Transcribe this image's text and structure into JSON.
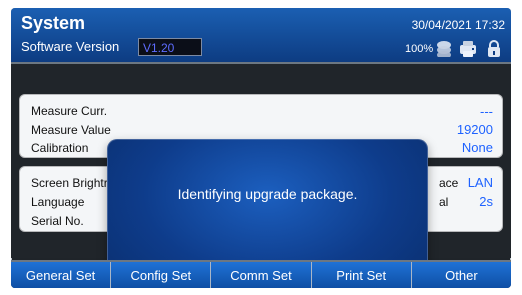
{
  "colors": {
    "header_blue": "#1b5fb2",
    "header_blue_dark": "#0d3c82",
    "panel_bg": "#f4f6f8",
    "value_blue": "#1e62ff",
    "overlay_blue": "#1c5fbf",
    "tab_blue": "#1f72d6"
  },
  "header": {
    "title": "System",
    "software_version_label": "Software Version",
    "software_version_value": "V1.20",
    "datetime": "30/04/2021 17:32",
    "battery_percent": "100%",
    "status_icons": [
      "network-icon",
      "printer-icon",
      "lock-icon"
    ]
  },
  "settings": {
    "rows": [
      {
        "label": "Measure Curr.",
        "value": "---"
      },
      {
        "label": "Measure Value",
        "value": "19200"
      },
      {
        "label": "Calibration",
        "value": "None"
      },
      {
        "label": "Screen Brightr",
        "value": "LAN",
        "right_label": "ace"
      },
      {
        "label": "Language",
        "value": "2s",
        "right_label": "al"
      },
      {
        "label": "Serial No.",
        "value": ""
      }
    ]
  },
  "dialog": {
    "message": "Identifying upgrade package."
  },
  "tabs": [
    {
      "label": "General Set"
    },
    {
      "label": "Config Set"
    },
    {
      "label": "Comm Set"
    },
    {
      "label": "Print Set"
    },
    {
      "label": "Other"
    }
  ]
}
